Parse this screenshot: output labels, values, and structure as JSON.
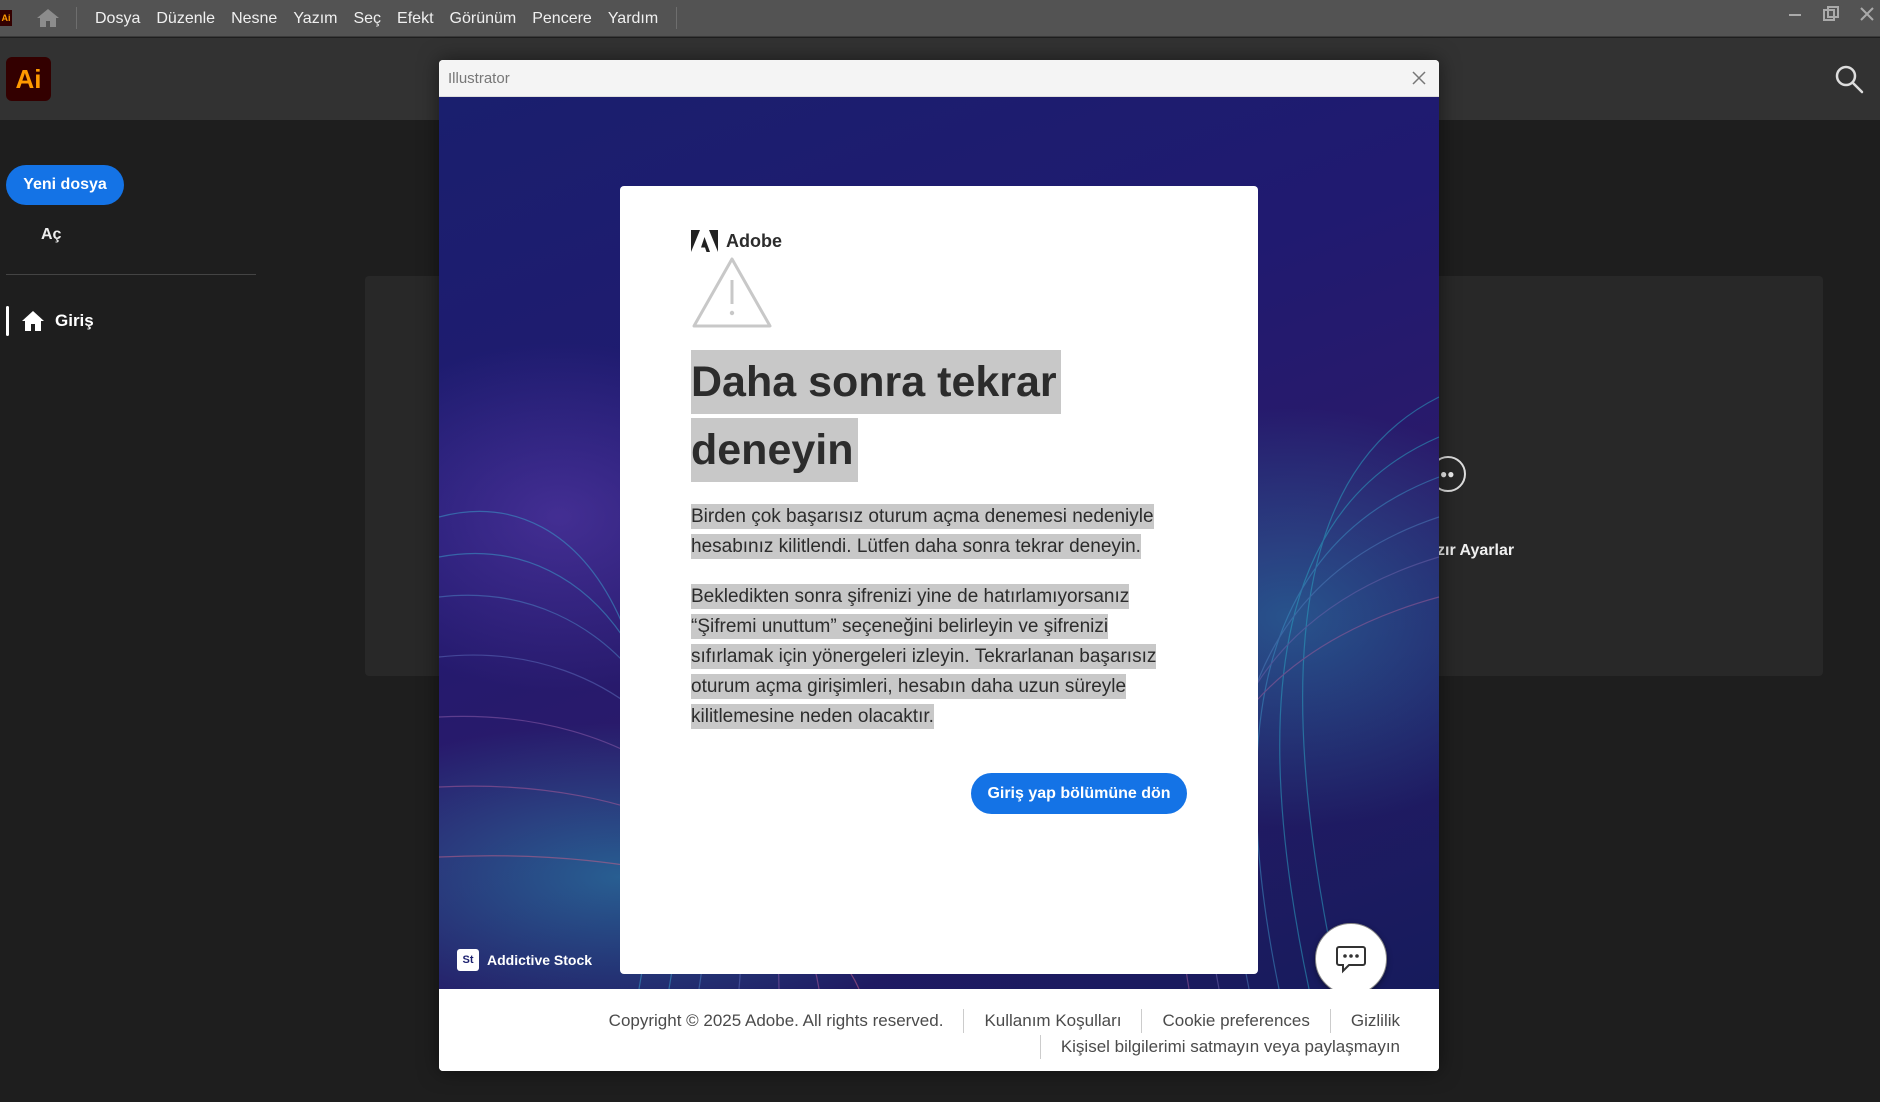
{
  "menubar": {
    "items": [
      "Dosya",
      "Düzenle",
      "Nesne",
      "Yazım",
      "Seç",
      "Efekt",
      "Görünüm",
      "Pencere",
      "Yardım"
    ]
  },
  "header": {
    "logo": "Ai",
    "search_icon": "search-icon"
  },
  "sidebar": {
    "new_file": "Yeni dosya",
    "open": "Aç",
    "home": "Giriş"
  },
  "background": {
    "presets_label": "zır Ayarlar"
  },
  "dialog": {
    "window_title": "Illustrator",
    "brand": "Adobe",
    "headline": "Daha sonra tekrar deneyin",
    "paragraph1": "Birden çok başarısız oturum açma denemesi nedeniyle hesabınız kilitlendi. Lütfen daha sonra tekrar deneyin.",
    "paragraph2": "Bekledikten sonra şifrenizi yine de hatırlamıyorsanız “Şifremi unuttum” seçeneğini belirleyin ve şifrenizi sıfırlamak için yönergeleri izleyin. Tekrarlanan başarısız oturum açma girişimleri, hesabın daha uzun süreyle kilitlemesine neden olacaktır.",
    "back_button": "Giriş yap bölümüne dön",
    "stock_badge": "St",
    "stock_credit": "Addictive Stock"
  },
  "footer": {
    "copyright": "Copyright © 2025 Adobe. All rights reserved.",
    "terms": "Kullanım Koşulları",
    "cookies": "Cookie preferences",
    "privacy": "Gizlilik",
    "do_not_sell": "Kişisel bilgilerimi satmayın veya paylaşmayın"
  },
  "colors": {
    "accent": "#1473e6",
    "ai_bg": "#330000",
    "ai_fg": "#ff9a00"
  }
}
